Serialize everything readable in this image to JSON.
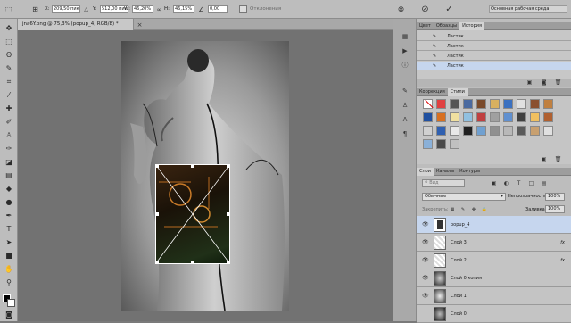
{
  "options": {
    "x_label": "X:",
    "x_value": "209,50 пик",
    "y_label": "Y:",
    "y_value": "512,00 пик",
    "w_label": "W:",
    "w_value": "46,20%",
    "h_label": "H:",
    "h_value": "46,15%",
    "angle_value": "0,00",
    "interp_label": "Отклонения",
    "cancel_icon": "cancel-icon",
    "commit_icon": "commit-check-icon",
    "workspace_value": "Основная рабочая среда"
  },
  "document": {
    "tab_title": "jna6Y.png @ 75,3% (popup_4, RGB/8) *"
  },
  "history": {
    "tabs": [
      "Цвет",
      "Образцы",
      "История"
    ],
    "active_tab": "История",
    "items": [
      {
        "label": "Ластик",
        "selected": false
      },
      {
        "label": "Ластик",
        "selected": false
      },
      {
        "label": "Ластик",
        "selected": false
      },
      {
        "label": "Ластик",
        "selected": true
      }
    ]
  },
  "styles": {
    "tabs": [
      "Коррекция",
      "Стили"
    ],
    "active_tab": "Стили"
  },
  "layers": {
    "tabs": [
      "Слои",
      "Каналы",
      "Контуры"
    ],
    "active_tab": "Слои",
    "filter_placeholder": "Вид",
    "blend_mode": "Обычные",
    "opacity_label": "Непрозрачность:",
    "opacity_value": "100%",
    "lock_label": "Закрепить:",
    "fill_label": "Заливка:",
    "fill_value": "100%",
    "items": [
      {
        "name": "popup_4",
        "selected": true,
        "fx": ""
      },
      {
        "name": "Слой 3",
        "selected": false,
        "fx": "fx"
      },
      {
        "name": "Слой 2",
        "selected": false,
        "fx": "fx"
      },
      {
        "name": "Слой 0 копия",
        "selected": false,
        "fx": ""
      },
      {
        "name": "Слой 1",
        "selected": false,
        "fx": ""
      },
      {
        "name": "Слой 0",
        "selected": false,
        "fx": ""
      }
    ]
  },
  "colors": {
    "selection_blue": "#c6d6ee",
    "panel_gray": "#bdbdbd",
    "canvas_gray": "#727272"
  }
}
